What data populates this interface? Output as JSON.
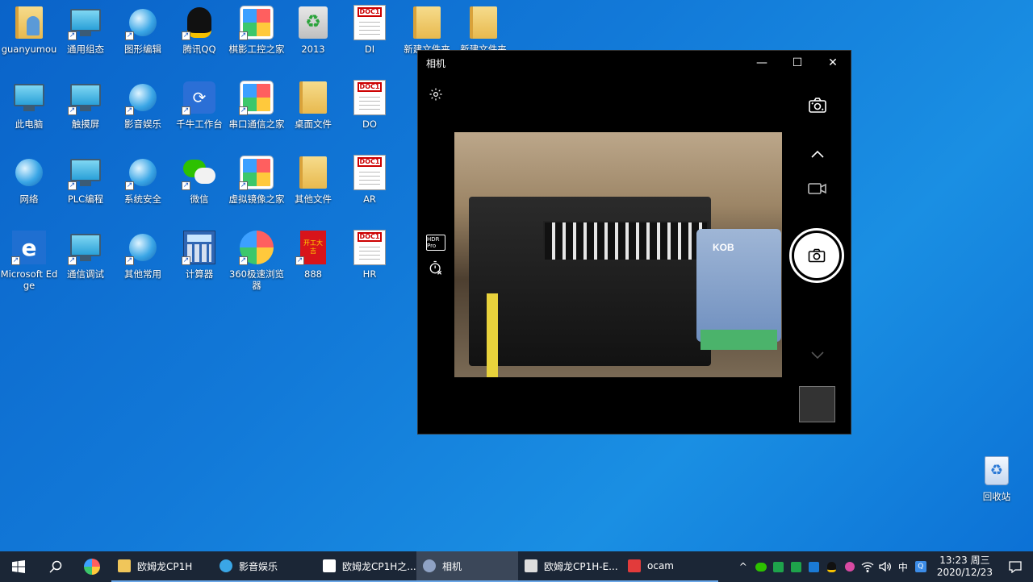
{
  "desktop": {
    "icons": [
      {
        "label": "guanyumou",
        "kind": "user-folder"
      },
      {
        "label": "通用组态",
        "kind": "monitor"
      },
      {
        "label": "图形编辑",
        "kind": "globe"
      },
      {
        "label": "腾讯QQ",
        "kind": "qq"
      },
      {
        "label": "棋影工控之家",
        "kind": "pinwheel"
      },
      {
        "label": "2013",
        "kind": "recycle-green"
      },
      {
        "label": "DI",
        "kind": "doc"
      },
      {
        "label": "新建文件夹",
        "kind": "folder"
      },
      {
        "label": "新建文件夹",
        "kind": "folder"
      },
      {
        "label": "此电脑",
        "kind": "monitor"
      },
      {
        "label": "触摸屏",
        "kind": "monitor"
      },
      {
        "label": "影音娱乐",
        "kind": "globe"
      },
      {
        "label": "千牛工作台",
        "kind": "qianniu"
      },
      {
        "label": "串口通信之家",
        "kind": "pinwheel"
      },
      {
        "label": "桌面文件",
        "kind": "folder"
      },
      {
        "label": "DO",
        "kind": "doc"
      },
      {
        "label": "网络",
        "kind": "globe"
      },
      {
        "label": "PLC编程",
        "kind": "monitor"
      },
      {
        "label": "系统安全",
        "kind": "globe"
      },
      {
        "label": "微信",
        "kind": "wechat"
      },
      {
        "label": "虚拟镜像之家",
        "kind": "pinwheel"
      },
      {
        "label": "其他文件",
        "kind": "folder"
      },
      {
        "label": "AR",
        "kind": "doc"
      },
      {
        "label": "Microsoft Edge",
        "kind": "edge"
      },
      {
        "label": "通信调试",
        "kind": "monitor"
      },
      {
        "label": "其他常用",
        "kind": "globe"
      },
      {
        "label": "计算器",
        "kind": "calculator"
      },
      {
        "label": "360极速浏览器",
        "kind": "browser360"
      },
      {
        "label": "888",
        "kind": "red-card"
      },
      {
        "label": "HR",
        "kind": "doc"
      }
    ],
    "doc_tag": "DOC1",
    "red_card_text": "开工大吉",
    "recycle_bin_label": "回收站"
  },
  "camera_window": {
    "title": "相机",
    "minimize": "—",
    "maximize": "☐",
    "close": "✕",
    "hdr_label": "HDR Pro",
    "converter_label": "KOB"
  },
  "taskbar": {
    "apps": [
      {
        "label": "欧姆龙CP1H",
        "icon": "folder-icon",
        "active": false
      },
      {
        "label": "影音娱乐",
        "icon": "globe-icon",
        "active": false
      },
      {
        "label": "欧姆龙CP1H之...",
        "icon": "pdf-icon",
        "active": false
      },
      {
        "label": "相机",
        "icon": "camera-icon",
        "active": true
      },
      {
        "label": "欧姆龙CP1H-E...",
        "icon": "plc-icon",
        "active": false
      },
      {
        "label": "ocam",
        "icon": "ocam-icon",
        "active": false
      }
    ],
    "ime": "中",
    "time": "13:23 周三",
    "date": "2020/12/23"
  },
  "colors": {
    "desktop_bg": "#1279d8",
    "taskbar_bg": "#1b2636",
    "active_underline": "#6aa7e8"
  }
}
